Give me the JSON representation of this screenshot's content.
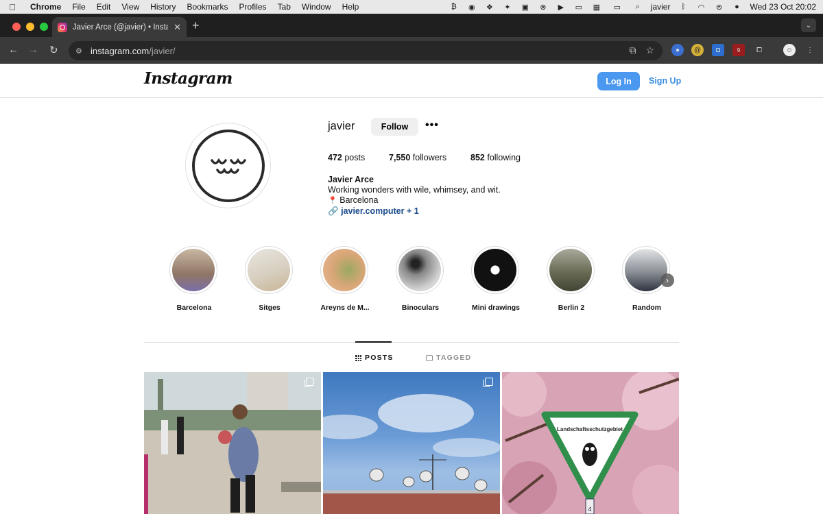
{
  "menubar": {
    "items": [
      "Chrome",
      "File",
      "Edit",
      "View",
      "History",
      "Bookmarks",
      "Profiles",
      "Tab",
      "Window",
      "Help"
    ],
    "user": "javier",
    "datetime": "Wed 23 Oct  20:02"
  },
  "browser": {
    "tab_title": "Javier Arce (@javier) • Instagram",
    "url_host": "instagram.com",
    "url_path": "/javier/",
    "extension_badge": "9"
  },
  "header": {
    "logo": "Instagram",
    "login_label": "Log In",
    "signup_label": "Sign Up"
  },
  "profile": {
    "username": "javier",
    "follow_label": "Follow",
    "more_label": "•••",
    "posts_count": "472",
    "posts_label": "posts",
    "followers_count": "7,550",
    "followers_label": "followers",
    "following_count": "852",
    "following_label": "following",
    "full_name": "Javier Arce",
    "bio": "Working wonders with wile, whimsey, and wit.",
    "location": "Barcelona",
    "link": "javier.computer + 1"
  },
  "highlights": [
    {
      "label": "Barcelona",
      "color": "#b59a84"
    },
    {
      "label": "Sitges",
      "color": "#d9d4c9"
    },
    {
      "label": "Areyns de M...",
      "color": "#d7a87a"
    },
    {
      "label": "Binoculars",
      "color": "#6e6e6e"
    },
    {
      "label": "Mini drawings",
      "color": "#111111"
    },
    {
      "label": "Berlin 2",
      "color": "#6c6a58"
    },
    {
      "label": "Random",
      "color": "#8a8f96"
    }
  ],
  "content_tabs": {
    "posts": "POSTS",
    "tagged": "TAGGED"
  },
  "colors": {
    "primary_button": "#4a98f0",
    "link": "#3a8ee0"
  }
}
